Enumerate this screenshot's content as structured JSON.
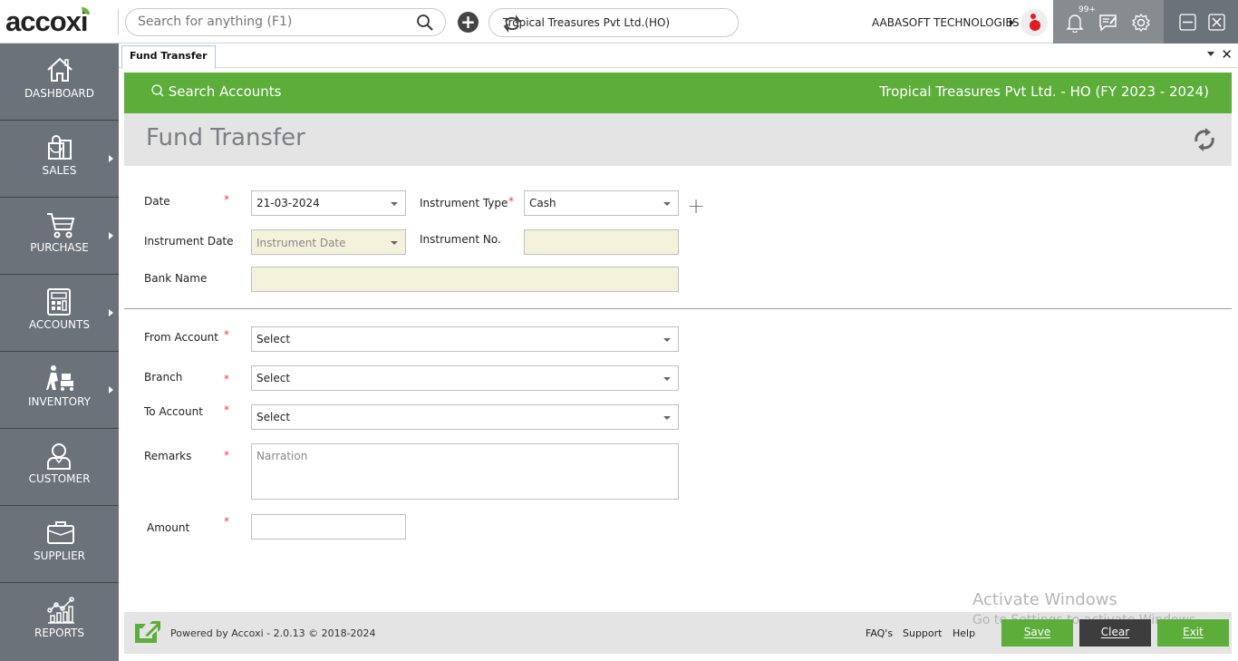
{
  "app": {
    "logo_text": "accoxi"
  },
  "topbar": {
    "search_placeholder": "Search for anything (F1)",
    "company_selector": "Tropical Treasures Pvt Ltd.(HO)",
    "user_name": "AABASOFT TECHNOLOGIES",
    "notification_count": "99+"
  },
  "sidebar": {
    "items": [
      {
        "label": "DASHBOARD",
        "icon": "home-icon",
        "has_submenu": false
      },
      {
        "label": "SALES",
        "icon": "shopping-bag-icon",
        "has_submenu": true
      },
      {
        "label": "PURCHASE",
        "icon": "cart-icon",
        "has_submenu": true
      },
      {
        "label": "ACCOUNTS",
        "icon": "calculator-icon",
        "has_submenu": true
      },
      {
        "label": "INVENTORY",
        "icon": "trolley-icon",
        "has_submenu": true
      },
      {
        "label": "CUSTOMER",
        "icon": "user-icon",
        "has_submenu": false
      },
      {
        "label": "SUPPLIER",
        "icon": "briefcase-icon",
        "has_submenu": false
      },
      {
        "label": "REPORTS",
        "icon": "chart-icon",
        "has_submenu": false
      }
    ]
  },
  "tabs": [
    {
      "label": "Fund Transfer",
      "active": true
    }
  ],
  "header": {
    "search_accounts": "Search Accounts",
    "company_fy": "Tropical Treasures Pvt Ltd. - HO (FY 2023 - 2024)",
    "page_title": "Fund Transfer"
  },
  "form": {
    "date": {
      "label": "Date",
      "value": "21-03-2024",
      "required": true
    },
    "instrument_type": {
      "label": "Instrument Type",
      "value": "Cash",
      "required": true
    },
    "instrument_date": {
      "label": "Instrument Date",
      "placeholder": "Instrument Date"
    },
    "instrument_no": {
      "label": "Instrument No.",
      "value": ""
    },
    "bank_name": {
      "label": "Bank Name",
      "value": ""
    },
    "from_account": {
      "label": "From Account",
      "value": "Select",
      "required": true
    },
    "branch": {
      "label": "Branch",
      "value": "Select",
      "required": true
    },
    "to_account": {
      "label": "To Account",
      "value": "Select",
      "required": true
    },
    "remarks": {
      "label": "Remarks",
      "placeholder": "Narration",
      "required": true
    },
    "amount": {
      "label": "Amount",
      "value": "",
      "required": true
    },
    "required_mark": "*"
  },
  "footer": {
    "powered_by": "Powered by Accoxi - 2.0.13 © 2018-2024",
    "links": [
      "FAQ's",
      "Support",
      "Help"
    ],
    "buttons": {
      "save": "Save",
      "clear": "Clear",
      "exit": "Exit"
    }
  },
  "watermark": {
    "line1": "Activate Windows",
    "line2": "Go to Settings to activate Windows."
  },
  "colors": {
    "brand_green": "#5dad3b",
    "sidebar": "#6b7279",
    "clear_button": "#3d3d3d",
    "required": "#e8403a"
  }
}
